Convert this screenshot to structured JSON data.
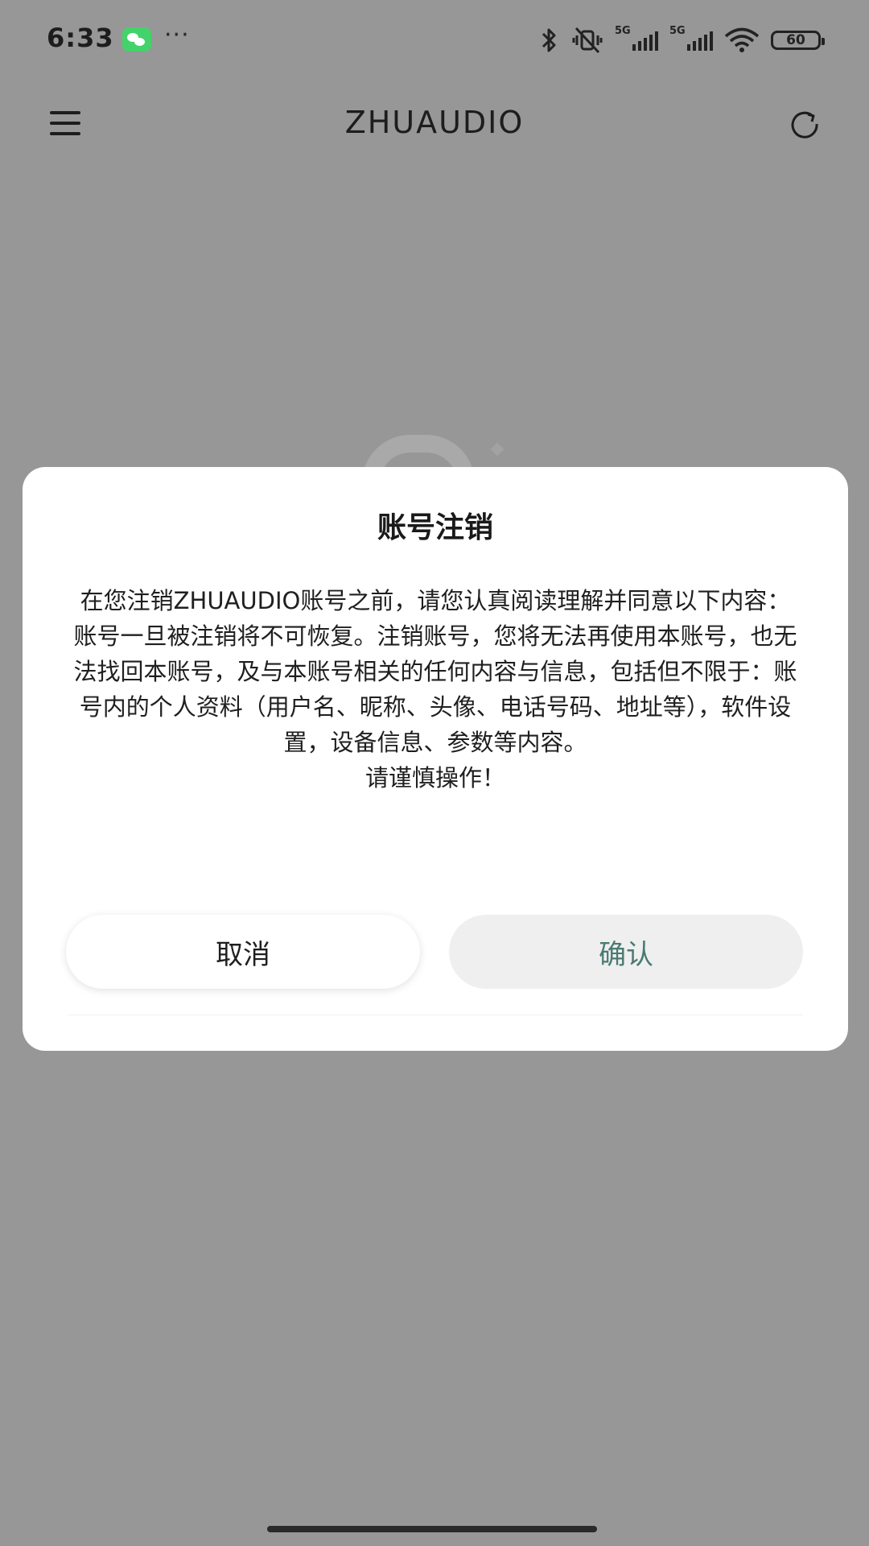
{
  "status_bar": {
    "time": "6:33",
    "more_dots": "···",
    "signal1_label": "5G",
    "signal2_label": "5G",
    "battery_level": "60"
  },
  "header": {
    "title": "ZHUAUDIO"
  },
  "dialog": {
    "title": "账号注销",
    "body": [
      "在您注销ZHUAUDIO账号之前，请您认真阅读理解并同意以下内容：",
      "账号一旦被注销将不可恢复。注销账号，您将无法再使用本账号，也无法找回本账号，及与本账号相关的任何内容与信息，包括但不限于：账号内的个人资料（用户名、昵称、头像、电话号码、地址等），软件设置，设备信息、参数等内容。",
      "请谨慎操作！"
    ],
    "cancel_label": "取消",
    "confirm_label": "确认"
  },
  "colors": {
    "overlay": "#979797",
    "dialog_bg": "#ffffff",
    "confirm_text": "#4a7a72",
    "wechat_green": "#43d36a"
  }
}
